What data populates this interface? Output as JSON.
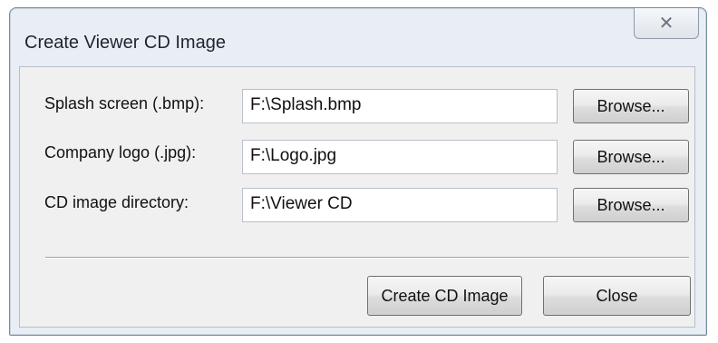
{
  "window": {
    "title": "Create Viewer CD Image",
    "close_glyph": "✕"
  },
  "rows": [
    {
      "label": "Splash screen (.bmp):",
      "value": "F:\\Splash.bmp",
      "browse_label": "Browse..."
    },
    {
      "label": "Company logo (.jpg):",
      "value": "F:\\Logo.jpg",
      "browse_label": "Browse..."
    },
    {
      "label": "CD image directory:",
      "value": "F:\\Viewer CD",
      "browse_label": "Browse..."
    }
  ],
  "actions": {
    "create_label": "Create CD Image",
    "close_label": "Close"
  }
}
